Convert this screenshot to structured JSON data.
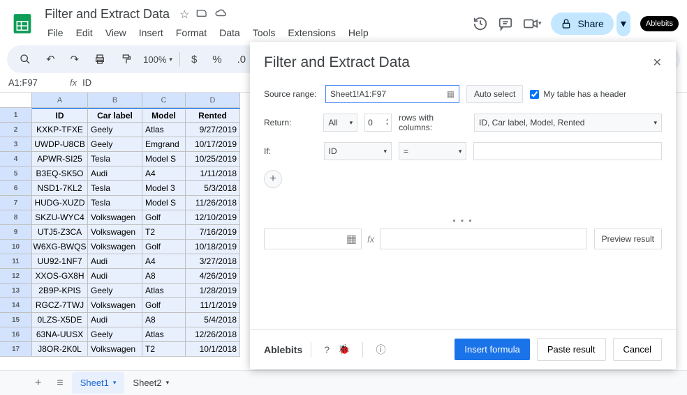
{
  "doc_title": "Filter and Extract Data",
  "menu": [
    "File",
    "Edit",
    "View",
    "Insert",
    "Format",
    "Data",
    "Tools",
    "Extensions",
    "Help"
  ],
  "share_label": "Share",
  "ablebits_badge": "Ablebits",
  "zoom": "100%",
  "namebox": "A1:F97",
  "formula_bar": "ID",
  "columns": [
    "A",
    "B",
    "C",
    "D"
  ],
  "headers": [
    "ID",
    "Car label",
    "Model",
    "Rented"
  ],
  "rows": [
    [
      "KXKP-TFXE",
      "Geely",
      "Atlas",
      "9/27/2019"
    ],
    [
      "UWDP-U8CB",
      "Geely",
      "Emgrand",
      "10/17/2019"
    ],
    [
      "APWR-SI25",
      "Tesla",
      "Model S",
      "10/25/2019"
    ],
    [
      "B3EQ-SK5O",
      "Audi",
      "A4",
      "1/11/2018"
    ],
    [
      "NSD1-7KL2",
      "Tesla",
      "Model 3",
      "5/3/2018"
    ],
    [
      "HUDG-XUZD",
      "Tesla",
      "Model S",
      "11/26/2018"
    ],
    [
      "SKZU-WYC4",
      "Volkswagen",
      "Golf",
      "12/10/2019"
    ],
    [
      "UTJ5-Z3CA",
      "Volkswagen",
      "T2",
      "7/16/2019"
    ],
    [
      "W6XG-BWQS",
      "Volkswagen",
      "Golf",
      "10/18/2019"
    ],
    [
      "UU92-1NF7",
      "Audi",
      "A4",
      "3/27/2018"
    ],
    [
      "XXOS-GX8H",
      "Audi",
      "A8",
      "4/26/2019"
    ],
    [
      "2B9P-KPIS",
      "Geely",
      "Atlas",
      "1/28/2019"
    ],
    [
      "RGCZ-7TWJ",
      "Volkswagen",
      "Golf",
      "11/1/2019"
    ],
    [
      "0LZS-X5DE",
      "Audi",
      "A8",
      "5/4/2018"
    ],
    [
      "63NA-UUSX",
      "Geely",
      "Atlas",
      "12/26/2018"
    ],
    [
      "J8OR-2K0L",
      "Volkswagen",
      "T2",
      "10/1/2018"
    ]
  ],
  "sheets": [
    {
      "name": "Sheet1",
      "active": true
    },
    {
      "name": "Sheet2",
      "active": false
    }
  ],
  "panel": {
    "title": "Filter and Extract Data",
    "source_label": "Source range:",
    "source_value": "Sheet1!A1:F97",
    "auto_select": "Auto select",
    "has_header": "My table has a header",
    "return_label": "Return:",
    "return_sel": "All",
    "return_num": "0",
    "rows_with": "rows with columns:",
    "cols_sel": "ID, Car label, Model, Rented",
    "if_label": "If:",
    "if_col": "ID",
    "if_op": "=",
    "preview_btn": "Preview result",
    "brand": "Ablebits",
    "insert_btn": "Insert formula",
    "paste_btn": "Paste result",
    "cancel_btn": "Cancel"
  }
}
